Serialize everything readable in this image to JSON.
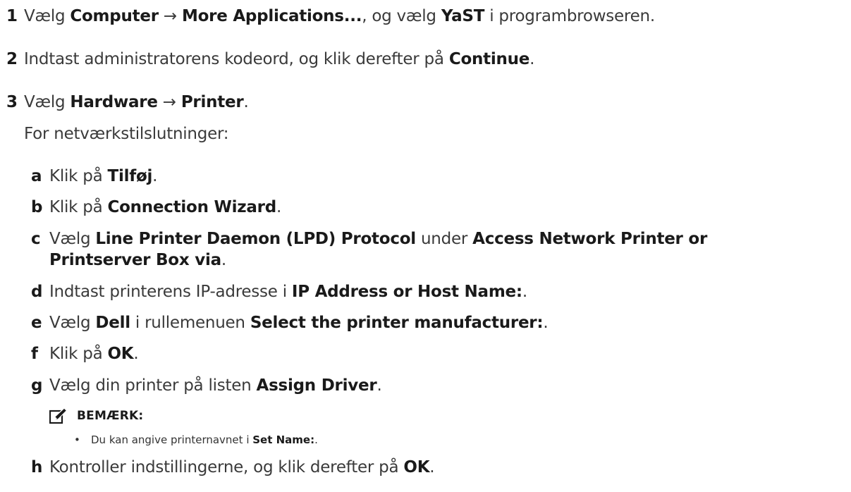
{
  "steps": [
    {
      "num": "1",
      "t1": "Vælg ",
      "b1": "Computer",
      "t2": " → ",
      "b2": "More Applications...",
      "t3": ", og vælg ",
      "b3": "YaST",
      "t4": " i programbrowseren."
    },
    {
      "num": "2",
      "t1": "Indtast administratorens kodeord, og klik derefter på ",
      "b1": "Continue",
      "t2": "."
    },
    {
      "num": "3",
      "t1": "Vælg ",
      "b1": "Hardware",
      "t2": " → ",
      "b2": "Printer",
      "t3": "."
    }
  ],
  "intro": "For netværkstilslutninger:",
  "substeps": {
    "a": {
      "letter": "a",
      "t1": "Klik på ",
      "b1": "Tilføj",
      "t2": "."
    },
    "b": {
      "letter": "b",
      "t1": "Klik på ",
      "b1": "Connection Wizard",
      "t2": "."
    },
    "c": {
      "letter": "c",
      "t1": "Vælg ",
      "b1": "Line Printer Daemon (LPD) Protocol",
      "t2": " under ",
      "b2": "Access Network Printer or",
      "b3": "Printserver Box via",
      "t3": "."
    },
    "d": {
      "letter": "d",
      "t1": "Indtast printerens IP-adresse i ",
      "b1": "IP Address or Host Name:",
      "t2": "."
    },
    "e": {
      "letter": "e",
      "t1": "Vælg ",
      "b1": "Dell",
      "t2": " i rullemenuen ",
      "b2": "Select the printer manufacturer:",
      "t3": "."
    },
    "f": {
      "letter": "f",
      "t1": "Klik på ",
      "b1": "OK",
      "t2": "."
    },
    "g": {
      "letter": "g",
      "t1": "Vælg din printer på listen ",
      "b1": "Assign Driver",
      "t2": "."
    },
    "h": {
      "letter": "h",
      "t1": "Kontroller indstillingerne, og klik derefter på ",
      "b1": "OK",
      "t2": "."
    }
  },
  "note": {
    "label": "BEMÆRK:",
    "bullet": "•",
    "item_t1": "Du kan angive printernavnet i ",
    "item_b1": "Set Name:",
    "item_t2": ".",
    "icon": "pencil-note-icon"
  }
}
